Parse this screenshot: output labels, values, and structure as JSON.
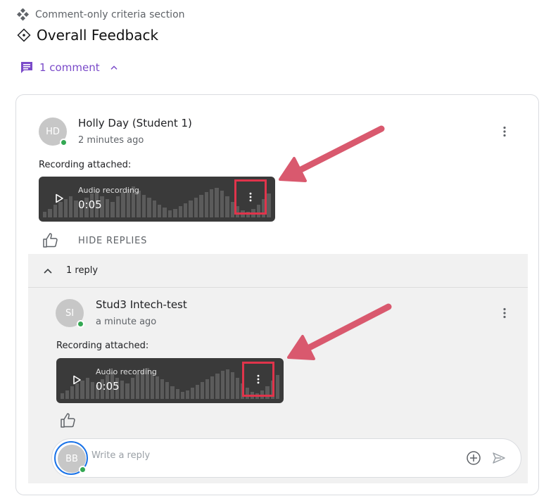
{
  "section": {
    "type_label": "Comment-only criteria section",
    "title": "Overall Feedback"
  },
  "comments_toggle": {
    "label": "1 comment"
  },
  "comment": {
    "avatar_initials": "HD",
    "author": "Holly Day (Student 1)",
    "time": "2 minutes ago",
    "recording_label": "Recording attached:",
    "audio": {
      "name": "Audio recording",
      "duration": "0:05"
    },
    "hide_replies_label": "HIDE REPLIES"
  },
  "replies": {
    "count_label": "1 reply",
    "items": [
      {
        "avatar_initials": "SI",
        "author": "Stud3 Intech-test",
        "time": "a minute ago",
        "recording_label": "Recording attached:",
        "audio": {
          "name": "Audio recording",
          "duration": "0:05"
        }
      }
    ]
  },
  "reply_input": {
    "avatar_initials": "BB",
    "placeholder": "Write a reply"
  },
  "colors": {
    "accent_purple": "#7a4ac9",
    "highlight_red": "#e0344b",
    "arrow_pink": "#d9596e",
    "online_green": "#34a853",
    "player_bg": "#3a3a3a"
  }
}
